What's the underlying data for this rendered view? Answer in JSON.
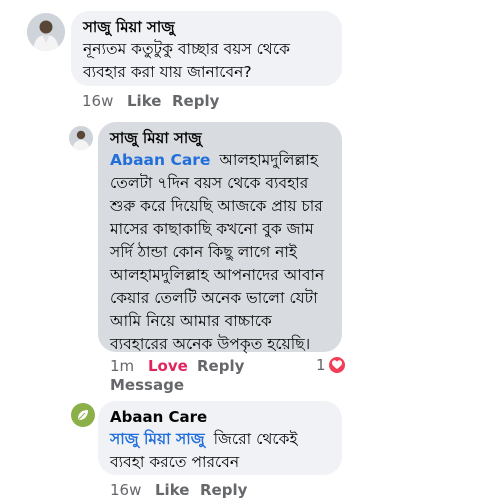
{
  "comment1": {
    "author": "সাজু মিয়া সাজু",
    "text": "নূন্যতম কতুটুকু বাচ্ছার বয়স থেকে ব্যবহার করা যায় জানাবেন?",
    "time": "16w",
    "like_label": "Like",
    "reply_label": "Reply"
  },
  "reply1": {
    "author": "সাজু মিয়া সাজু",
    "mention": "Abaan Care",
    "text": "আলহামদুলিল্লাহ তেলটা ৭দিন বয়স থেকে ব্যবহার শুরু করে দিয়েছি আজকে প্রায় চার মাসের কাছাকাছি কখনো বুক জাম সর্দি ঠান্ডা কোন কিছু লাগে নাই আলহামদুলিল্লাহ আপনাদের আবান কেয়ার তেলটি অনেক ভালো যেটা আমি নিয়ে আমার বাচ্চাকে ব্যবহারের অনেক উপকৃত হয়েছি।",
    "time": "1m",
    "love_label": "Love",
    "reply_label": "Reply",
    "message_label": "Message",
    "reaction_count": "1",
    "reaction_icon": "heart-icon",
    "reaction_color": "#f33e58"
  },
  "reply2": {
    "author": "Abaan Care",
    "mention": "সাজু মিয়া সাজু",
    "text": "জিরো থেকেই ব্যবহা করতে পারবেন",
    "time": "16w",
    "like_label": "Like",
    "reply_label": "Reply",
    "avatar_icon": "leaf-logo-icon",
    "avatar_color": "#8bb04a"
  },
  "colors": {
    "bubble": "#f0f2f5",
    "bubble_highlight": "#d8dbe0",
    "mention": "#216fdb",
    "meta": "#65676b",
    "love": "#e0245e"
  }
}
